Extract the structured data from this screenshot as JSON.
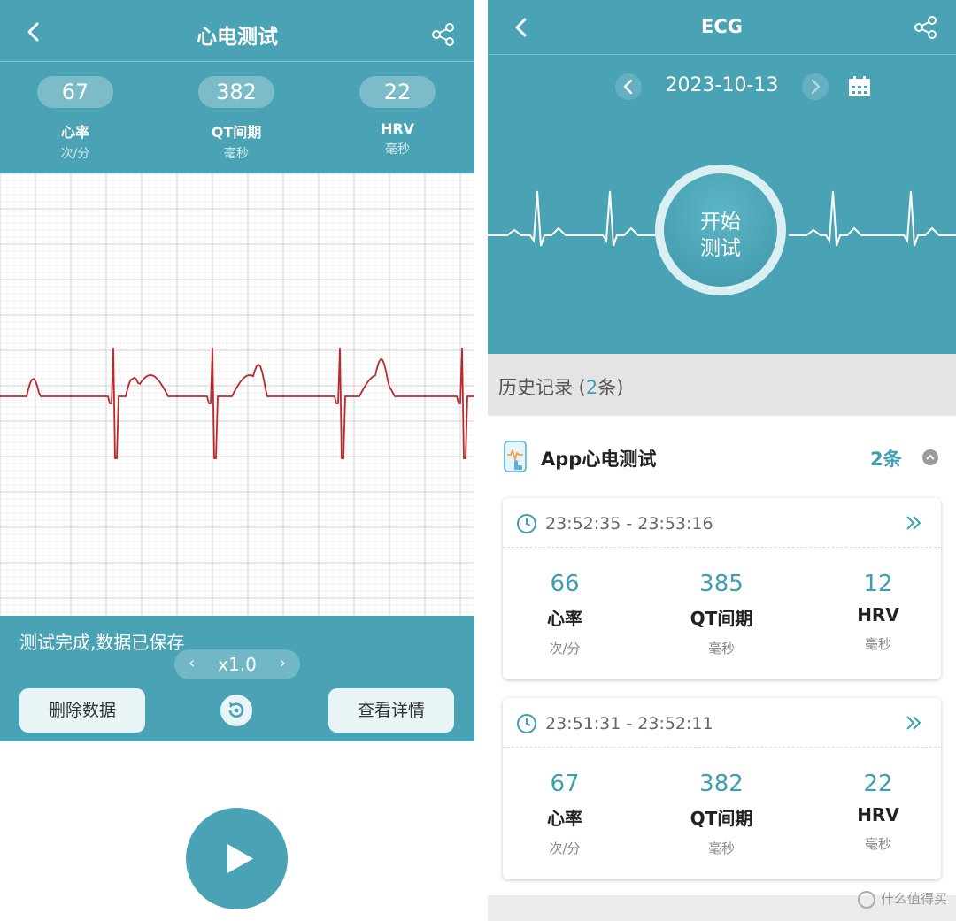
{
  "left": {
    "title": "心电测试",
    "stats": [
      {
        "value": "67",
        "label": "心率",
        "unit": "次/分"
      },
      {
        "value": "382",
        "label": "QT间期",
        "unit": "毫秒"
      },
      {
        "value": "22",
        "label": "HRV",
        "unit": "毫秒"
      }
    ],
    "status": "测试完成,数据已保存",
    "speed": "x1.0",
    "delete_label": "删除数据",
    "detail_label": "查看详情",
    "grid_color": "#e3e3e3",
    "trace_color": "#c0272d",
    "icons": {
      "back": "back-chevron-icon",
      "share": "share-icon",
      "replay": "replay-icon",
      "play": "play-icon"
    }
  },
  "right": {
    "title": "ECG",
    "date": "2023-10-13",
    "start_label_line1": "开始",
    "start_label_line2": "测试",
    "history_prefix": "历史记录 (",
    "history_count": "2",
    "history_suffix": "条)",
    "group": {
      "title": "App心电测试",
      "count": "2条"
    },
    "records": [
      {
        "time": "23:52:35 - 23:53:16",
        "metrics": [
          {
            "value": "66",
            "label": "心率",
            "unit": "次/分"
          },
          {
            "value": "385",
            "label": "QT间期",
            "unit": "毫秒"
          },
          {
            "value": "12",
            "label": "HRV",
            "unit": "毫秒"
          }
        ]
      },
      {
        "time": "23:51:31 - 23:52:11",
        "metrics": [
          {
            "value": "67",
            "label": "心率",
            "unit": "次/分"
          },
          {
            "value": "382",
            "label": "QT间期",
            "unit": "毫秒"
          },
          {
            "value": "22",
            "label": "HRV",
            "unit": "毫秒"
          }
        ]
      }
    ],
    "accent": "#4aa3b5",
    "highlight": "#3c9fb3"
  },
  "watermark": "什么值得买"
}
